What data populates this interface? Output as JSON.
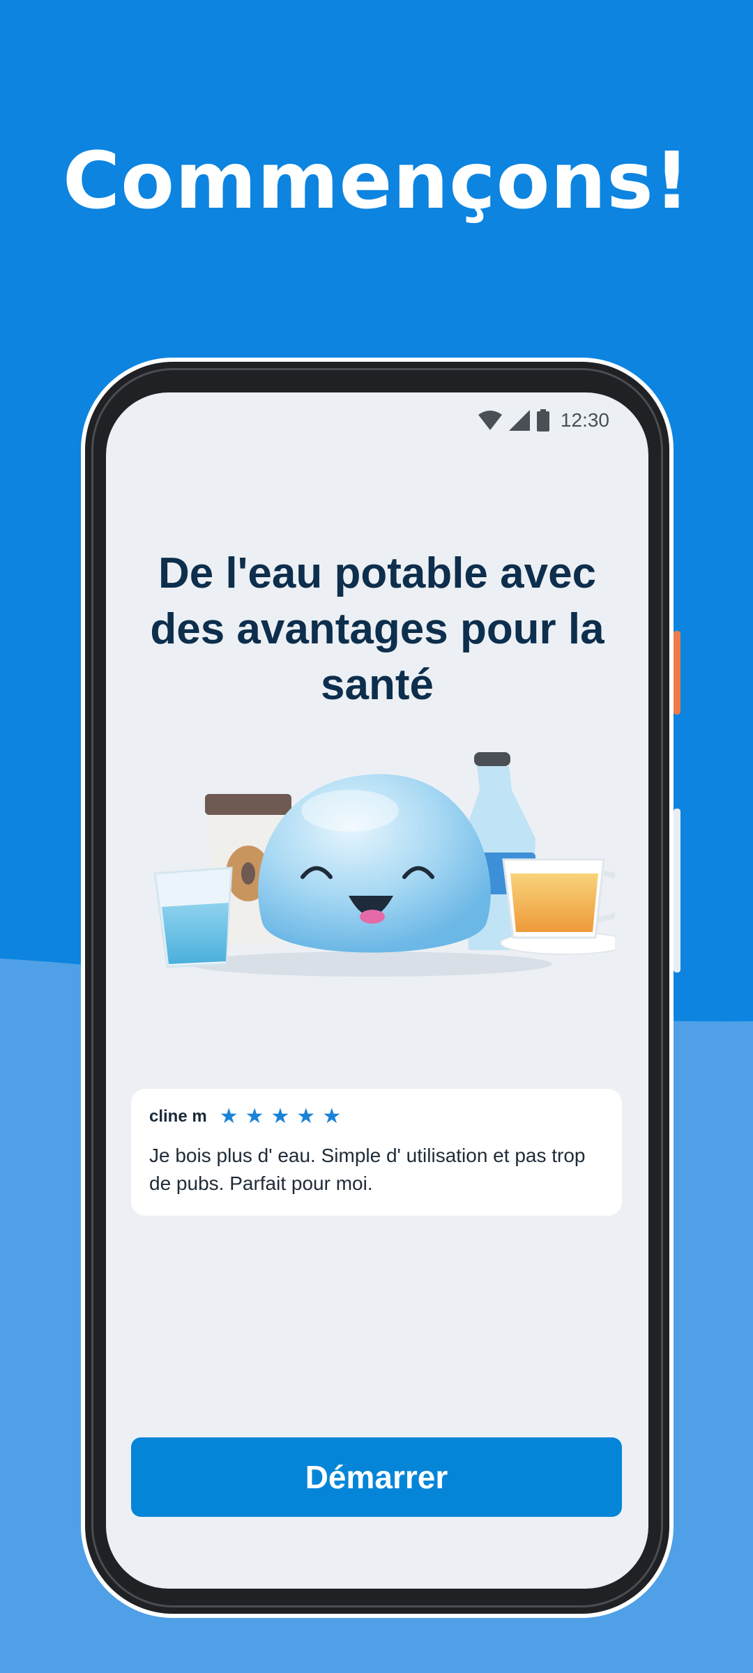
{
  "promo": {
    "title": "Commençons!"
  },
  "status_bar": {
    "time": "12:30",
    "icons": [
      "wifi-icon",
      "signal-icon",
      "battery-icon"
    ]
  },
  "screen": {
    "title": "De l'eau potable avec des avantages pour la santé",
    "illustration": "water-drop-mascot-with-drinks"
  },
  "review": {
    "author": "cline m",
    "rating": 5,
    "stars": [
      "★",
      "★",
      "★",
      "★",
      "★"
    ],
    "text": "Je bois plus d' eau. Simple d' utilisation et pas trop de pubs. Parfait pour moi."
  },
  "cta": {
    "label": "Démarrer"
  },
  "colors": {
    "background": "#0c84e0",
    "wave": "#4fa0e6",
    "screen": "#ecf0f4",
    "title": "#0d2e4c",
    "button": "#0585d8",
    "star": "#1a82d8"
  }
}
